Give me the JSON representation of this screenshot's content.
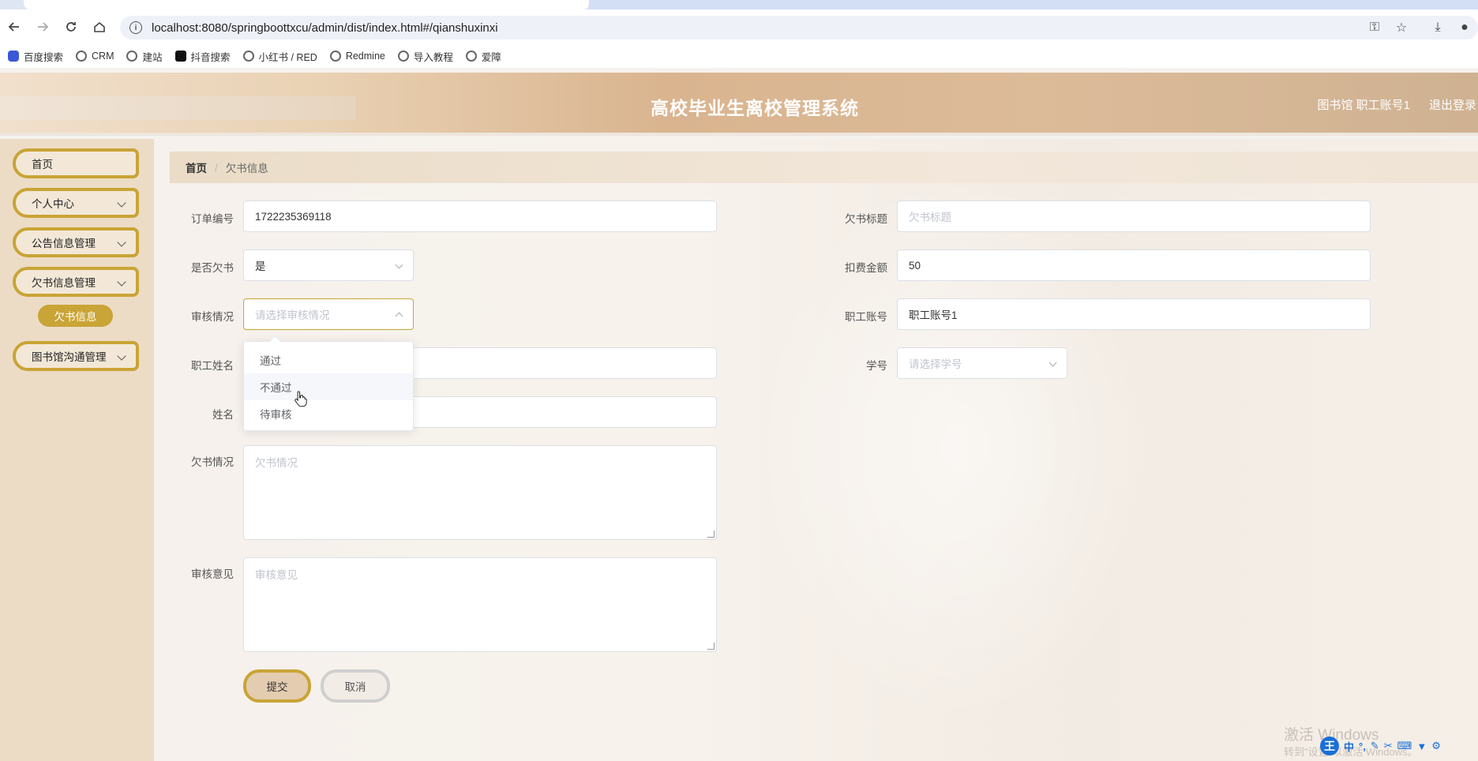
{
  "browser": {
    "url": "localhost:8080/springboottxcu/admin/dist/index.html#/qianshuxinxi",
    "bookmarks": [
      "百度搜索",
      "CRM",
      "建站",
      "抖音搜索",
      "小红书 / RED",
      "Redmine",
      "导入教程",
      "爱障"
    ]
  },
  "header": {
    "title": "高校毕业生离校管理系统",
    "user": "图书馆 职工账号1",
    "logout": "退出登录"
  },
  "sidebar": {
    "items": [
      {
        "label": "首页"
      },
      {
        "label": "个人中心"
      },
      {
        "label": "公告信息管理"
      },
      {
        "label": "欠书信息管理"
      },
      {
        "label": "图书馆沟通管理"
      }
    ],
    "active_sub": "欠书信息"
  },
  "breadcrumb": {
    "home": "首页",
    "current": "欠书信息"
  },
  "form": {
    "order_no": {
      "label": "订单编号",
      "value": "1722235369118"
    },
    "owe_title": {
      "label": "欠书标题",
      "placeholder": "欠书标题"
    },
    "is_owe": {
      "label": "是否欠书",
      "value": "是"
    },
    "fee": {
      "label": "扣费金额",
      "value": "50"
    },
    "review_status": {
      "label": "审核情况",
      "placeholder": "请选择审核情况"
    },
    "staff_account": {
      "label": "职工账号",
      "value": "职工账号1"
    },
    "staff_name": {
      "label": "职工姓名"
    },
    "student_no": {
      "label": "学号",
      "placeholder": "请选择学号"
    },
    "name": {
      "label": "姓名"
    },
    "owe_detail": {
      "label": "欠书情况",
      "placeholder": "欠书情况"
    },
    "review_comment": {
      "label": "审核意见",
      "placeholder": "审核意见"
    },
    "dropdown_options": [
      "通过",
      "不通过",
      "待审核"
    ],
    "submit": "提交",
    "cancel": "取消"
  },
  "watermark": {
    "line1": "激活 Windows",
    "line2": "转到\"设置\"以激活 Windows。"
  },
  "ime": {
    "logo": "王",
    "mode": "中"
  },
  "colors": {
    "accent": "#c9a436",
    "header_text": "#ffffff"
  }
}
